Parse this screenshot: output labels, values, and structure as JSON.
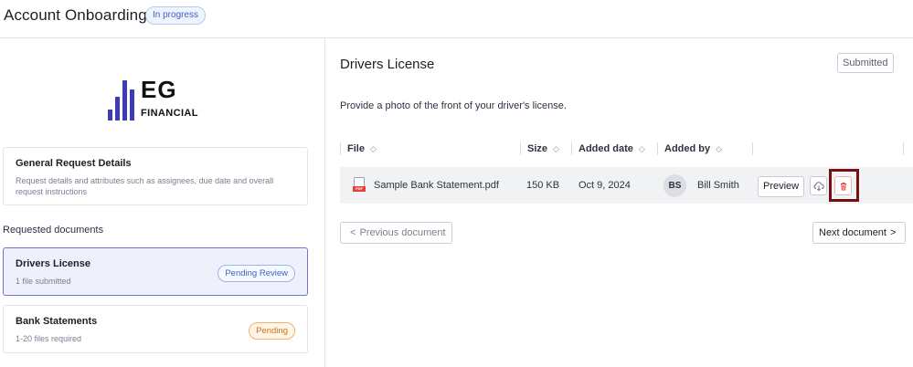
{
  "header": {
    "title": "Account Onboarding",
    "status": "In progress"
  },
  "logo": {
    "line1": "EG",
    "line2": "FINANCIAL",
    "color": "#3d3bb6"
  },
  "general": {
    "title": "General Request Details",
    "description": "Request details and attributes such as assignees, due date and overall request instructions"
  },
  "requested": {
    "label": "Requested documents",
    "documents": [
      {
        "title": "Drivers License",
        "subtitle": "1 file submitted",
        "badge": "Pending Review"
      },
      {
        "title": "Bank Statements",
        "subtitle": "1-20 files required",
        "badge": "Pending"
      }
    ]
  },
  "detail": {
    "title": "Drivers License",
    "status_button": "Submitted",
    "instructions": "Provide a photo of the front of your driver's license.",
    "columns": [
      "File",
      "Size",
      "Added date",
      "Added by"
    ],
    "file": {
      "name": "Sample Bank Statement.pdf",
      "type_tag": "PDF",
      "size": "150 KB",
      "added_date": "Oct 9, 2024",
      "added_by_initials": "BS",
      "added_by": "Bill Smith",
      "preview_label": "Preview"
    },
    "prev_label": "Previous document",
    "next_label": "Next document"
  },
  "colors": {
    "accent": "#3b64c7",
    "selected_border": "#7076d4",
    "delete_red": "#e0433b",
    "highlight": "#7a0d12"
  }
}
